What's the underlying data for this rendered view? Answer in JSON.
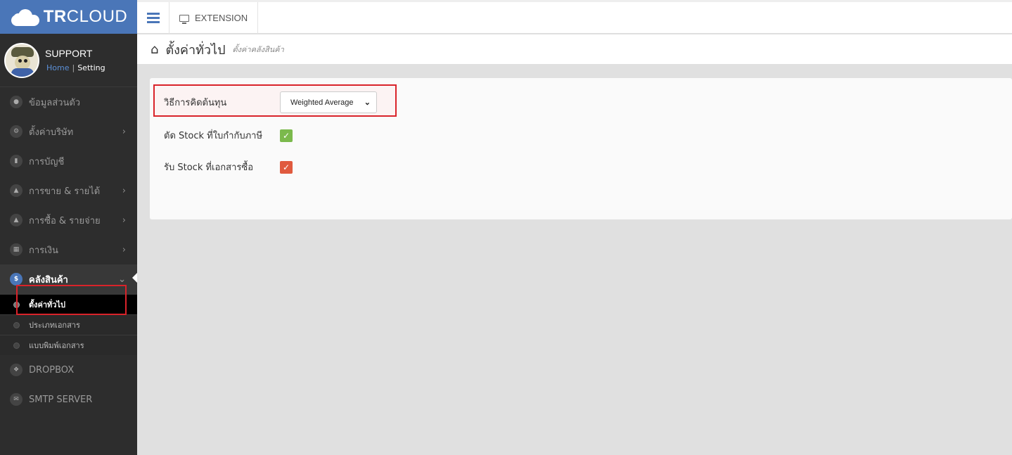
{
  "brand": {
    "name_bold": "TR",
    "name_rest": "CLOUD"
  },
  "profile": {
    "name": "SUPPORT",
    "crumb_home": "Home",
    "crumb_sep": "|",
    "crumb_current": "Setting"
  },
  "topbar": {
    "extension_label": "EXTENSION"
  },
  "sidebar": {
    "items": [
      {
        "label": "ข้อมูลส่วนตัว",
        "icon": "user-icon"
      },
      {
        "label": "ตั้งค่าบริษัท",
        "icon": "gear-icon",
        "chevron": true
      },
      {
        "label": "การบัญชี",
        "icon": "book-icon"
      },
      {
        "label": "การขาย & รายได้",
        "icon": "cart-icon",
        "chevron": true
      },
      {
        "label": "การซื้อ & รายจ่าย",
        "icon": "cart-icon",
        "chevron": true
      },
      {
        "label": "การเงิน",
        "icon": "calendar-icon",
        "chevron": true
      },
      {
        "label": "คลังสินค้า",
        "icon": "dollar-icon",
        "active": true
      },
      {
        "label": "DROPBOX",
        "icon": "dropbox-icon"
      },
      {
        "label": "SMTP SERVER",
        "icon": "envelope-icon"
      }
    ],
    "subitems": [
      {
        "label": "ตั้งค่าทั่วไป",
        "current": true
      },
      {
        "label": "ประเภทเอกสาร"
      },
      {
        "label": "แบบพิมพ์เอกสาร"
      }
    ]
  },
  "header": {
    "title": "ตั้งค่าทั่วไป",
    "subtitle": "ตั้งค่าคลังสินค้า"
  },
  "form": {
    "cost_method_label": "วิธีการคิดต้นทุน",
    "cost_method_value": "Weighted Average",
    "cut_stock_label": "ตัด Stock ที่ใบกำกับภาษี",
    "cut_stock_checked": true,
    "receive_stock_label": "รับ Stock ที่เอกสารซื้อ",
    "receive_stock_checked": true
  },
  "colors": {
    "brand_blue": "#4a76b8",
    "sidebar_bg": "#2d2d2d",
    "highlight_red": "#d9232a",
    "check_green": "#7bb94c",
    "check_red": "#e05a3e"
  }
}
